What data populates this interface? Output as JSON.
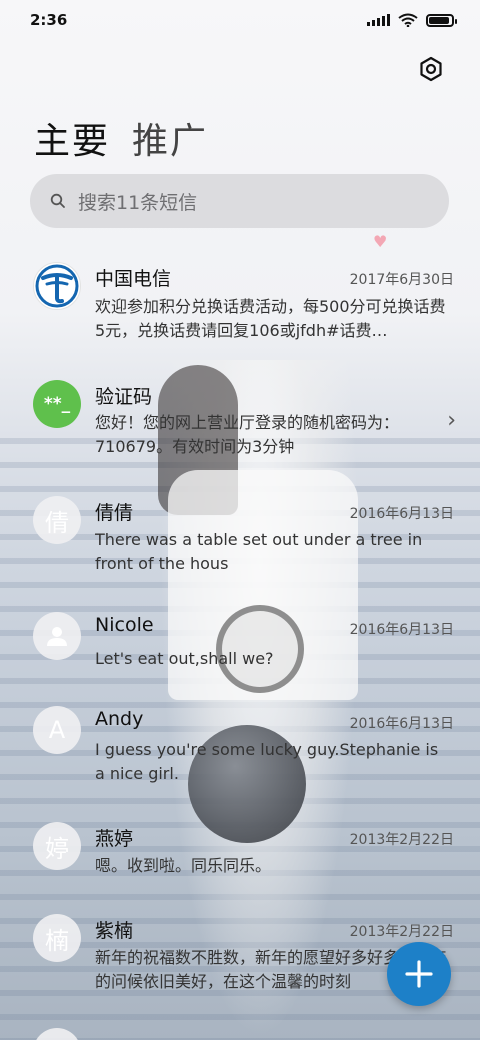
{
  "status_bar": {
    "time": "2:36",
    "battery_percent": 90
  },
  "tabs": [
    {
      "label": "主要",
      "active": true
    },
    {
      "label": "推广",
      "active": false
    }
  ],
  "search": {
    "placeholder": "搜索11条短信"
  },
  "conversations": [
    {
      "name": "中国电信",
      "date": "2017年6月30日",
      "preview": "欢迎参加积分兑换话费活动，每500分可兑换话费5元，兑换话费请回复106或jfdh#话费…",
      "avatar_type": "telecom-logo",
      "avatar_text": ""
    },
    {
      "name": "验证码",
      "date": "",
      "preview": "您好！您的网上营业厅登录的随机密码为：710679。有效时间为3分钟",
      "avatar_type": "code",
      "avatar_text": "**_"
    },
    {
      "name": "倩倩",
      "date": "2016年6月13日",
      "preview": "There was a table set out under a tree in front of the hous",
      "avatar_type": "text",
      "avatar_text": "倩"
    },
    {
      "name": "Nicole",
      "date": "2016年6月13日",
      "preview": "Let's eat out,shall we?",
      "avatar_type": "person-icon",
      "avatar_text": ""
    },
    {
      "name": "Andy",
      "date": "2016年6月13日",
      "preview": "I guess you're some lucky guy.Stephanie is a nice girl.",
      "avatar_type": "text",
      "avatar_text": "A"
    },
    {
      "name": "燕婷",
      "date": "2013年2月22日",
      "preview": "嗯。收到啦。同乐同乐。",
      "avatar_type": "text",
      "avatar_text": "婷"
    },
    {
      "name": "紫楠",
      "date": "2013年2月22日",
      "preview": "新年的祝福数不胜数，新年的愿望好多好多，新年的问候依旧美好，在这个温馨的时刻",
      "avatar_type": "text",
      "avatar_text": "楠"
    }
  ],
  "colors": {
    "fab": "#1d80c8",
    "code_avatar": "#5fc04c",
    "telecom_blue": "#1466b0"
  },
  "icons": {
    "settings": "settings-icon",
    "search": "search-icon",
    "compose": "plus-icon"
  }
}
